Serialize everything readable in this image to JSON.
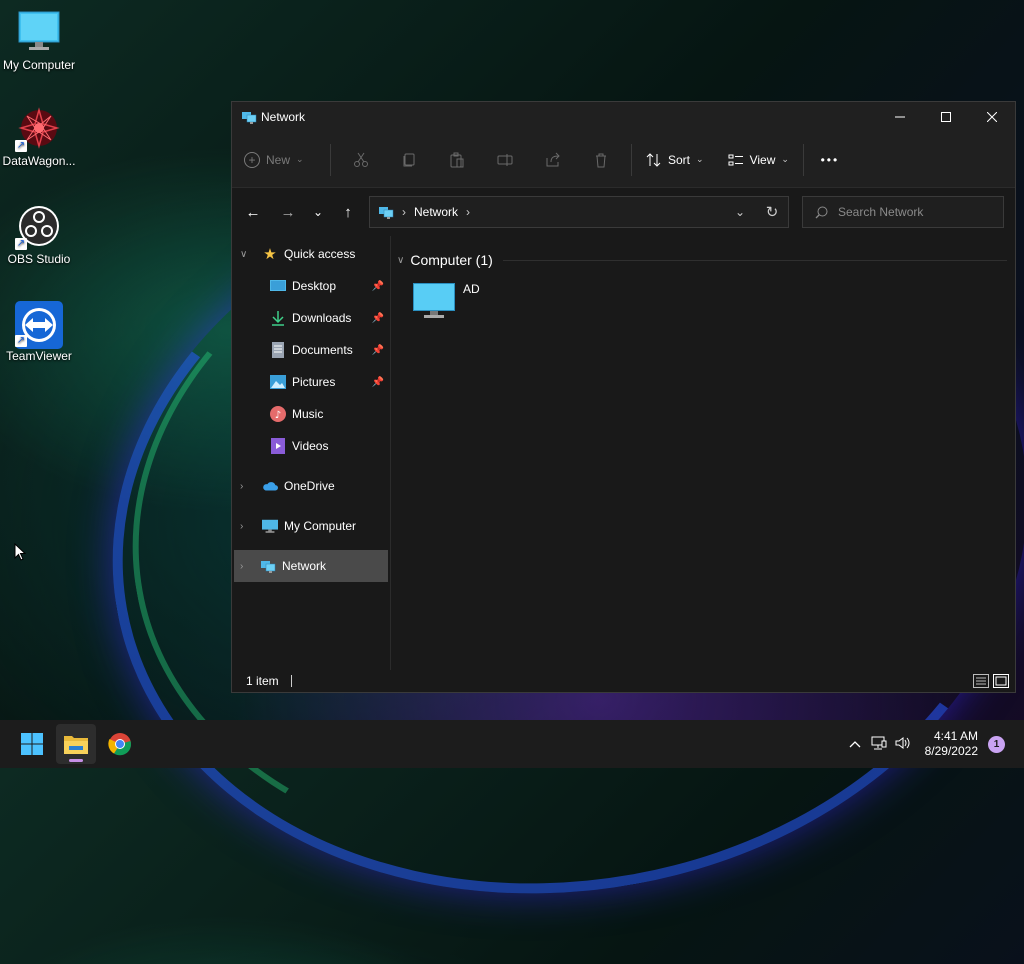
{
  "desktop": {
    "icons": [
      {
        "label": "My Computer",
        "icon": "monitor-icon"
      },
      {
        "label": "DataWagon...",
        "icon": "datawagon-icon"
      },
      {
        "label": "OBS Studio",
        "icon": "obs-icon"
      },
      {
        "label": "TeamViewer",
        "icon": "teamviewer-icon"
      }
    ]
  },
  "window": {
    "title": "Network",
    "controls": {
      "minimize": "—",
      "maximize": "☐",
      "close": "✕"
    }
  },
  "toolbar": {
    "new_label": "New",
    "sort_label": "Sort",
    "view_label": "View",
    "more_label": "•••",
    "icons": [
      "cut-icon",
      "copy-icon",
      "paste-icon",
      "rename-icon",
      "share-icon",
      "delete-icon"
    ]
  },
  "nav": {
    "back": "←",
    "forward": "→",
    "recent": "⌄",
    "up": "↑",
    "breadcrumb": [
      "Network"
    ],
    "separator": "›",
    "dropdown": "⌄",
    "refresh": "↻"
  },
  "search": {
    "placeholder": "Search Network"
  },
  "sidebar": {
    "quick_access": {
      "label": "Quick access",
      "items": [
        {
          "label": "Desktop",
          "pinned": true
        },
        {
          "label": "Downloads",
          "pinned": true
        },
        {
          "label": "Documents",
          "pinned": true
        },
        {
          "label": "Pictures",
          "pinned": true
        },
        {
          "label": "Music",
          "pinned": false
        },
        {
          "label": "Videos",
          "pinned": false
        }
      ]
    },
    "onedrive": "OneDrive",
    "my_computer": "My Computer",
    "network": "Network"
  },
  "main": {
    "group_header": "Computer (1)",
    "items": [
      {
        "label": "AD",
        "icon": "monitor-icon"
      }
    ]
  },
  "status": {
    "count": "1 item"
  },
  "taskbar": {
    "clock_time": "4:41 AM",
    "clock_date": "8/29/2022",
    "notification_count": "1"
  },
  "colors": {
    "accent": "#4cc2ff",
    "window_bg": "#191919",
    "selected_bg": "#4a4a4a",
    "taskbar_bg": "#1c1c1c"
  }
}
